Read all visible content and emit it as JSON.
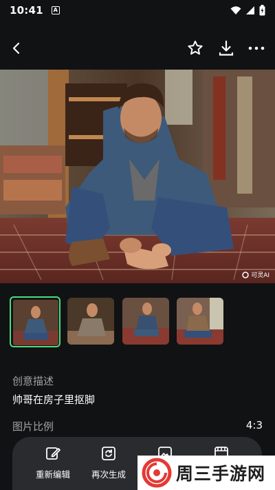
{
  "status": {
    "time": "10:41",
    "a_badge": "A"
  },
  "hero": {
    "watermark": "可灵AI"
  },
  "details": {
    "creative_label": "创意描述",
    "creative_value": "帅哥在房子里抠脚",
    "ratio_label": "图片比例",
    "ratio_value": "4:3"
  },
  "actions": [
    {
      "label": "重新编辑",
      "icon": "edit-icon"
    },
    {
      "label": "再次生成",
      "icon": "regenerate-icon"
    },
    {
      "label": "",
      "icon": "image-icon"
    },
    {
      "label": "",
      "icon": "frames-icon"
    }
  ],
  "overlay": {
    "brand": "周三手游网"
  },
  "colors": {
    "accent": "#4ade80",
    "background": "#111214",
    "action_bar": "#2a2b2e"
  }
}
